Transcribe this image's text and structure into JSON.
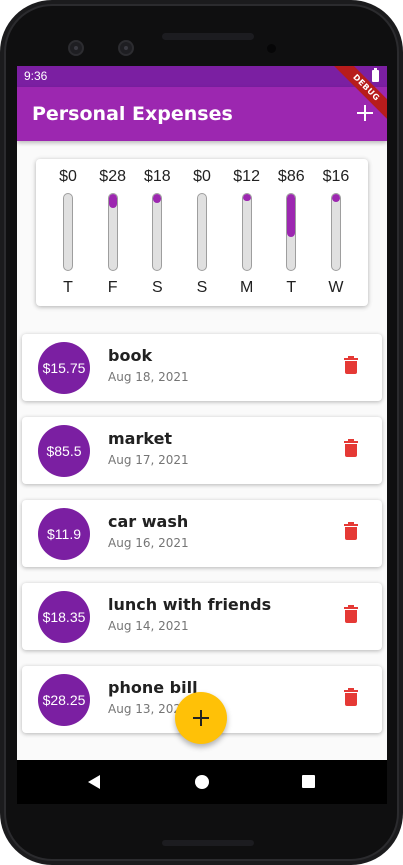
{
  "status_bar": {
    "time": "9:36",
    "debug_label": "DEBUG"
  },
  "app_bar": {
    "title": "Personal Expenses",
    "add_icon": "plus-icon"
  },
  "chart": {
    "days": [
      {
        "label": "T",
        "amount": "$0",
        "fraction": 0.0
      },
      {
        "label": "F",
        "amount": "$28",
        "fraction": 0.19
      },
      {
        "label": "S",
        "amount": "$18",
        "fraction": 0.12
      },
      {
        "label": "S",
        "amount": "$0",
        "fraction": 0.0
      },
      {
        "label": "M",
        "amount": "$12",
        "fraction": 0.08
      },
      {
        "label": "T",
        "amount": "$86",
        "fraction": 0.56
      },
      {
        "label": "W",
        "amount": "$16",
        "fraction": 0.1
      }
    ],
    "accent_color": "#9c27b0"
  },
  "transactions": [
    {
      "amount": "$15.75",
      "title": "book",
      "date": "Aug 18, 2021"
    },
    {
      "amount": "$85.5",
      "title": "market",
      "date": "Aug 17, 2021"
    },
    {
      "amount": "$11.9",
      "title": "car wash",
      "date": "Aug 16, 2021"
    },
    {
      "amount": "$18.35",
      "title": "lunch with friends",
      "date": "Aug 14, 2021"
    },
    {
      "amount": "$28.25",
      "title": "phone bill",
      "date": "Aug 13, 2021"
    }
  ],
  "colors": {
    "primary": "#9c27b0",
    "primary_dark": "#7b1fa2",
    "accent": "#ffc107",
    "delete": "#e53935"
  }
}
